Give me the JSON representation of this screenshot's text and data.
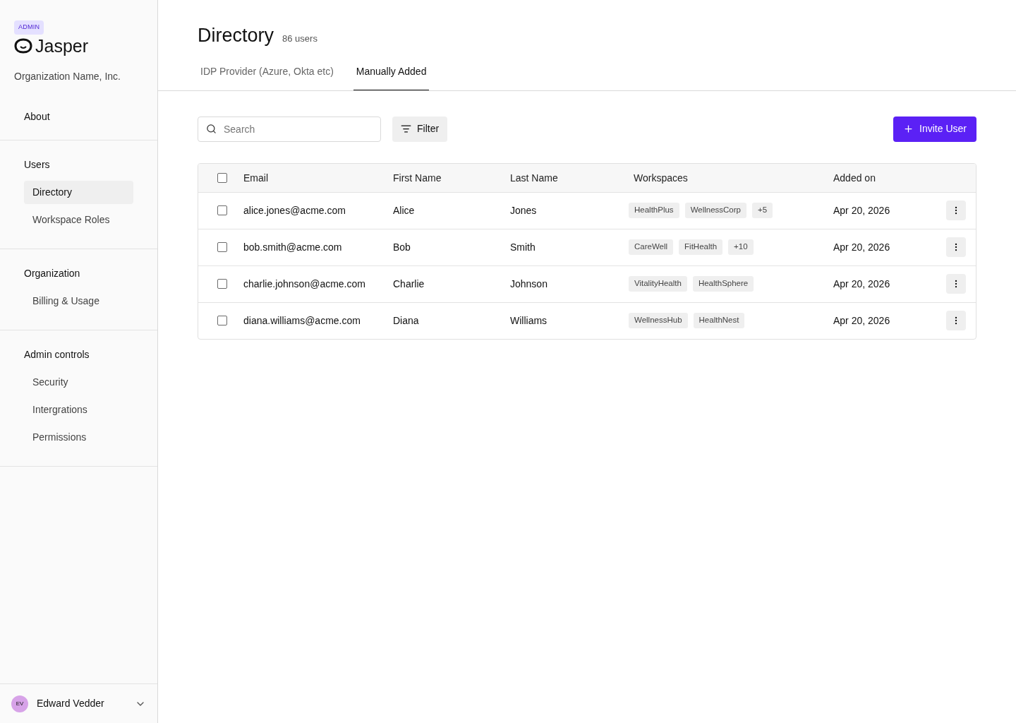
{
  "sidebar": {
    "badge": "ADMIN",
    "logo_text": "Jasper",
    "org_name": "Organization Name, Inc.",
    "sections": [
      {
        "heading": "About"
      },
      {
        "heading": "Users",
        "items": [
          {
            "label": "Directory",
            "selected": true
          },
          {
            "label": "Workspace Roles",
            "selected": false
          }
        ]
      },
      {
        "heading": "Organization",
        "items": [
          {
            "label": "Billing & Usage",
            "selected": false
          }
        ]
      },
      {
        "heading": "Admin controls",
        "items": [
          {
            "label": "Security",
            "selected": false
          },
          {
            "label": "Intergrations",
            "selected": false
          },
          {
            "label": "Permissions",
            "selected": false
          }
        ]
      }
    ],
    "user": {
      "initials": "EV",
      "name": "Edward Vedder"
    }
  },
  "header": {
    "title": "Directory",
    "count": "86 users"
  },
  "tabs": [
    {
      "label": "IDP Provider (Azure, Okta etc)",
      "selected": false
    },
    {
      "label": "Manually Added",
      "selected": true
    }
  ],
  "toolbar": {
    "search_placeholder": "Search",
    "filter_label": "Filter",
    "invite_label": "Invite User"
  },
  "table": {
    "all_checked": false,
    "columns": [
      "Email",
      "First Name",
      "Last Name",
      "Workspaces",
      "Added on"
    ],
    "rows": [
      {
        "checked": false,
        "email": "alice.jones@acme.com",
        "first": "Alice",
        "last": "Jones",
        "workspaces": [
          "HealthPlus",
          "WellnessCorp",
          "+5"
        ],
        "added": "Apr 20, 2026"
      },
      {
        "checked": false,
        "email": "bob.smith@acme.com",
        "first": "Bob",
        "last": "Smith",
        "workspaces": [
          "CareWell",
          "FitHealth",
          "+10"
        ],
        "added": "Apr 20, 2026"
      },
      {
        "checked": false,
        "email": "charlie.johnson@acme.com",
        "first": "Charlie",
        "last": "Johnson",
        "workspaces": [
          "VitalityHealth",
          "HealthSphere"
        ],
        "added": "Apr 20, 2026"
      },
      {
        "checked": false,
        "email": "diana.williams@acme.com",
        "first": "Diana",
        "last": "Williams",
        "workspaces": [
          "WellnessHub",
          "HealthNest"
        ],
        "added": "Apr 20, 2026"
      }
    ]
  }
}
